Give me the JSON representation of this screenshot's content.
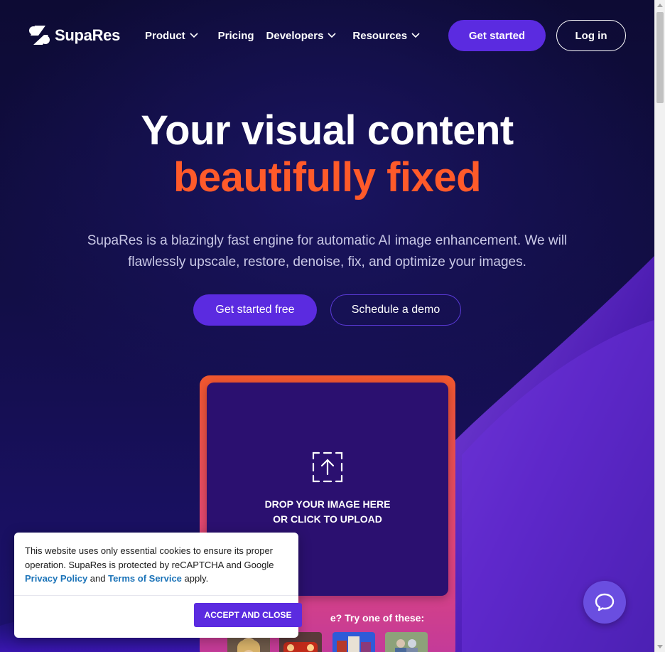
{
  "header": {
    "logo_text": "SupaRes",
    "nav": [
      {
        "label": "Product",
        "has_dropdown": true
      },
      {
        "label": "Pricing",
        "has_dropdown": false
      },
      {
        "label": "Developers",
        "has_dropdown": true
      },
      {
        "label": "Resources",
        "has_dropdown": true
      }
    ],
    "get_started_label": "Get started",
    "login_label": "Log in"
  },
  "hero": {
    "title_line1": "Your visual content",
    "title_line2": "beautifully fixed",
    "subtitle": "SupaRes is a blazingly fast engine for automatic AI image enhancement. We will flawlessly upscale, restore, denoise, fix, and optimize your images.",
    "cta_primary": "Get started free",
    "cta_secondary": "Schedule a demo"
  },
  "upload": {
    "line1": "DROP YOUR IMAGE HERE",
    "line2": "OR CLICK TO UPLOAD",
    "try_text": "e? Try one of these:",
    "sample_icons": [
      "portrait-sample",
      "car-sample",
      "building-sample",
      "couple-sample"
    ]
  },
  "cookie": {
    "text_before": "This website uses only essential cookies to ensure its proper operation. SupaRes is protected by reCAPTCHA and Google ",
    "privacy_link": "Privacy Policy",
    "text_and": " and ",
    "terms_link": "Terms of Service",
    "text_after": " apply.",
    "accept_label": "ACCEPT AND CLOSE"
  },
  "colors": {
    "accent": "#5b2be0",
    "headline_orange": "#ff5a2a",
    "background": "#0d0b34",
    "link": "#1b73b8"
  },
  "icons": {
    "chat": "chat-bubble-icon",
    "upload": "upload-icon"
  }
}
